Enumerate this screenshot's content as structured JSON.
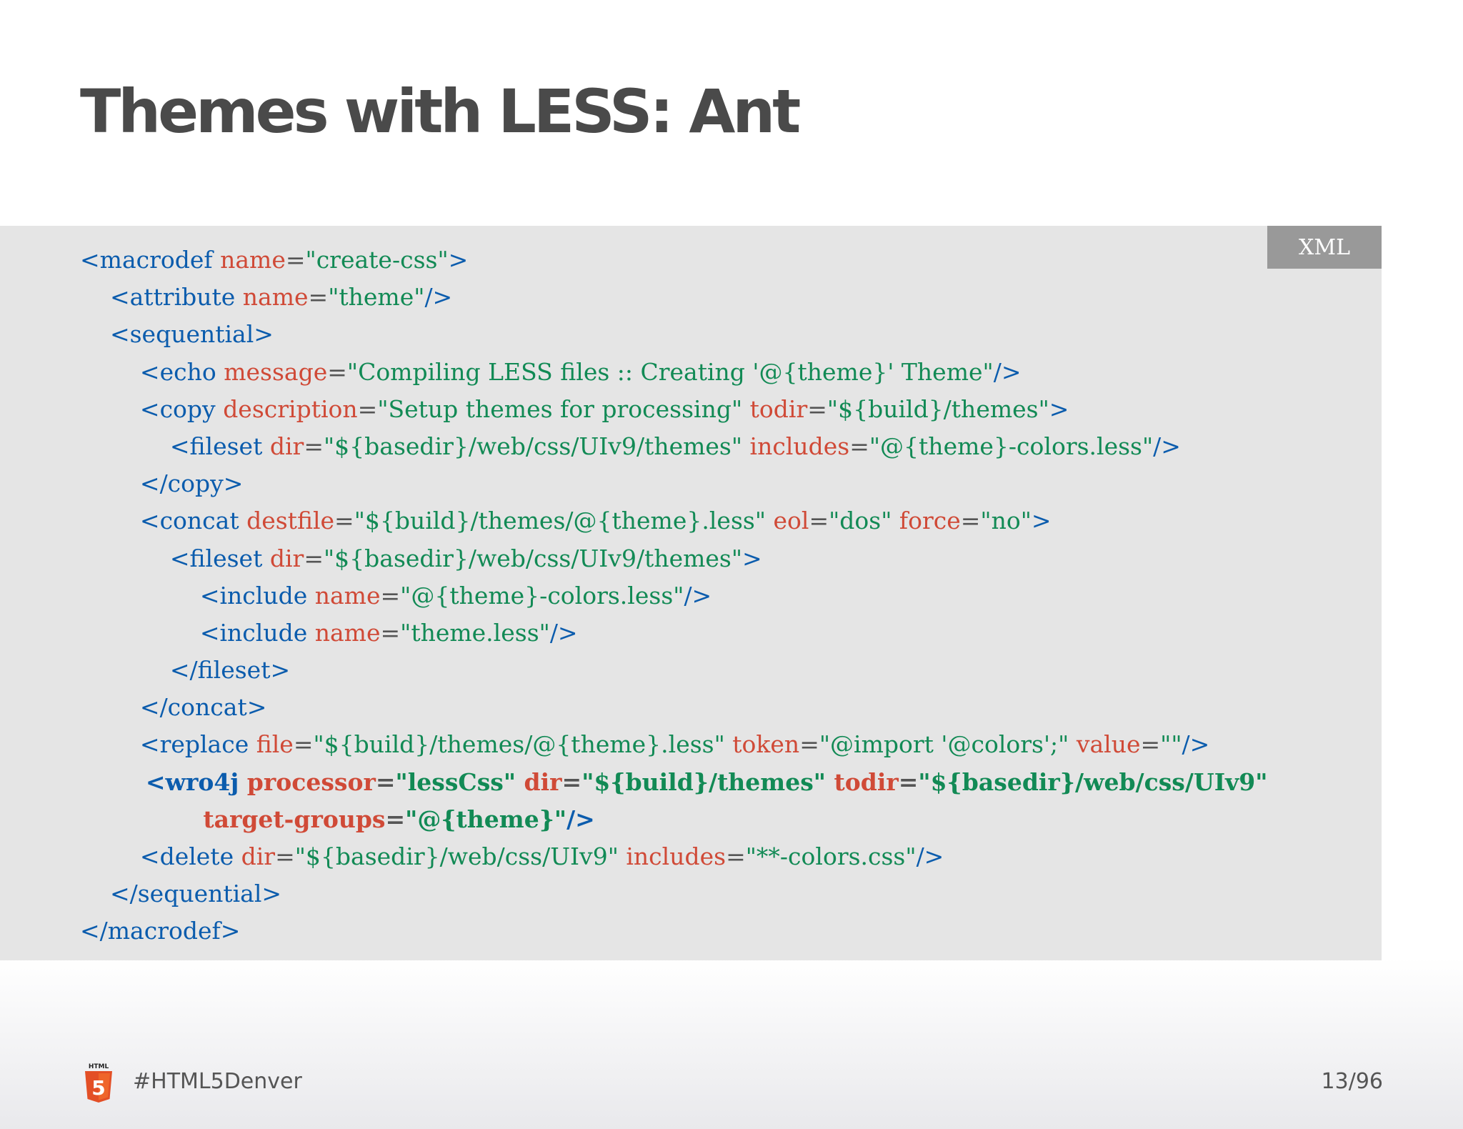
{
  "slide": {
    "title": "Themes with LESS: Ant",
    "code_language_badge": "XML",
    "footer": {
      "logo_icon": "html5-logo-icon",
      "logo_text": "HTML",
      "logo_number": "5",
      "hashtag": "#HTML5Denver",
      "page_number": "13/96"
    }
  },
  "colors": {
    "tag": "#0b5cad",
    "attribute": "#d04a37",
    "value": "#128a55",
    "title": "#4a4a4a",
    "code_background": "#e5e5e5",
    "badge_background": "#999999"
  },
  "code": {
    "highlighted_lines": [
      14,
      15
    ],
    "lines": [
      [
        {
          "t": "t",
          "s": "<macrodef "
        },
        {
          "t": "a",
          "s": "name"
        },
        {
          "t": "p",
          "s": "="
        },
        {
          "t": "v",
          "s": "\"create-css\""
        },
        {
          "t": "t",
          "s": ">"
        }
      ],
      [
        {
          "t": "t",
          "s": "    <attribute "
        },
        {
          "t": "a",
          "s": "name"
        },
        {
          "t": "p",
          "s": "="
        },
        {
          "t": "v",
          "s": "\"theme\""
        },
        {
          "t": "t",
          "s": "/>"
        }
      ],
      [
        {
          "t": "t",
          "s": "    <sequential>"
        }
      ],
      [
        {
          "t": "t",
          "s": "        <echo "
        },
        {
          "t": "a",
          "s": "message"
        },
        {
          "t": "p",
          "s": "="
        },
        {
          "t": "v",
          "s": "\"Compiling LESS files :: Creating '@{theme}' Theme\""
        },
        {
          "t": "t",
          "s": "/>"
        }
      ],
      [
        {
          "t": "t",
          "s": "        <copy "
        },
        {
          "t": "a",
          "s": "description"
        },
        {
          "t": "p",
          "s": "="
        },
        {
          "t": "v",
          "s": "\"Setup themes for processing\" "
        },
        {
          "t": "a",
          "s": "todir"
        },
        {
          "t": "p",
          "s": "="
        },
        {
          "t": "v",
          "s": "\"${build}/themes\""
        },
        {
          "t": "t",
          "s": ">"
        }
      ],
      [
        {
          "t": "t",
          "s": "            <fileset "
        },
        {
          "t": "a",
          "s": "dir"
        },
        {
          "t": "p",
          "s": "="
        },
        {
          "t": "v",
          "s": "\"${basedir}/web/css/UIv9/themes\" "
        },
        {
          "t": "a",
          "s": "includes"
        },
        {
          "t": "p",
          "s": "="
        },
        {
          "t": "v",
          "s": "\"@{theme}-colors.less\""
        },
        {
          "t": "t",
          "s": "/>"
        }
      ],
      [
        {
          "t": "t",
          "s": "        </copy>"
        }
      ],
      [
        {
          "t": "t",
          "s": "        <concat "
        },
        {
          "t": "a",
          "s": "destfile"
        },
        {
          "t": "p",
          "s": "="
        },
        {
          "t": "v",
          "s": "\"${build}/themes/@{theme}.less\" "
        },
        {
          "t": "a",
          "s": "eol"
        },
        {
          "t": "p",
          "s": "="
        },
        {
          "t": "v",
          "s": "\"dos\" "
        },
        {
          "t": "a",
          "s": "force"
        },
        {
          "t": "p",
          "s": "="
        },
        {
          "t": "v",
          "s": "\"no\""
        },
        {
          "t": "t",
          "s": ">"
        }
      ],
      [
        {
          "t": "t",
          "s": "            <fileset "
        },
        {
          "t": "a",
          "s": "dir"
        },
        {
          "t": "p",
          "s": "="
        },
        {
          "t": "v",
          "s": "\"${basedir}/web/css/UIv9/themes\""
        },
        {
          "t": "t",
          "s": ">"
        }
      ],
      [
        {
          "t": "t",
          "s": "                <include "
        },
        {
          "t": "a",
          "s": "name"
        },
        {
          "t": "p",
          "s": "="
        },
        {
          "t": "v",
          "s": "\"@{theme}-colors.less\""
        },
        {
          "t": "t",
          "s": "/>"
        }
      ],
      [
        {
          "t": "t",
          "s": "                <include "
        },
        {
          "t": "a",
          "s": "name"
        },
        {
          "t": "p",
          "s": "="
        },
        {
          "t": "v",
          "s": "\"theme.less\""
        },
        {
          "t": "t",
          "s": "/>"
        }
      ],
      [
        {
          "t": "t",
          "s": "            </fileset>"
        }
      ],
      [
        {
          "t": "t",
          "s": "        </concat>"
        }
      ],
      [
        {
          "t": "t",
          "s": "        <replace "
        },
        {
          "t": "a",
          "s": "file"
        },
        {
          "t": "p",
          "s": "="
        },
        {
          "t": "v",
          "s": "\"${build}/themes/@{theme}.less\" "
        },
        {
          "t": "a",
          "s": "token"
        },
        {
          "t": "p",
          "s": "="
        },
        {
          "t": "v",
          "s": "\"@import '@colors';\" "
        },
        {
          "t": "a",
          "s": "value"
        },
        {
          "t": "p",
          "s": "="
        },
        {
          "t": "v",
          "s": "\"\""
        },
        {
          "t": "t",
          "s": "/>"
        }
      ],
      [
        {
          "t": "t",
          "s": "        <wro4j "
        },
        {
          "t": "a",
          "s": "processor"
        },
        {
          "t": "p",
          "s": "="
        },
        {
          "t": "v",
          "s": "\"lessCss\" "
        },
        {
          "t": "a",
          "s": "dir"
        },
        {
          "t": "p",
          "s": "="
        },
        {
          "t": "v",
          "s": "\"${build}/themes\" "
        },
        {
          "t": "a",
          "s": "todir"
        },
        {
          "t": "p",
          "s": "="
        },
        {
          "t": "v",
          "s": "\"${basedir}/web/css/UIv9\""
        }
      ],
      [
        {
          "t": "t",
          "s": "               "
        },
        {
          "t": "a",
          "s": "target-groups"
        },
        {
          "t": "p",
          "s": "="
        },
        {
          "t": "v",
          "s": "\"@{theme}\""
        },
        {
          "t": "t",
          "s": "/>"
        }
      ],
      [
        {
          "t": "t",
          "s": "        <delete "
        },
        {
          "t": "a",
          "s": "dir"
        },
        {
          "t": "p",
          "s": "="
        },
        {
          "t": "v",
          "s": "\"${basedir}/web/css/UIv9\" "
        },
        {
          "t": "a",
          "s": "includes"
        },
        {
          "t": "p",
          "s": "="
        },
        {
          "t": "v",
          "s": "\"**-colors.css\""
        },
        {
          "t": "t",
          "s": "/>"
        }
      ],
      [
        {
          "t": "t",
          "s": "    </sequential>"
        }
      ],
      [
        {
          "t": "t",
          "s": "</macrodef>"
        }
      ]
    ]
  }
}
